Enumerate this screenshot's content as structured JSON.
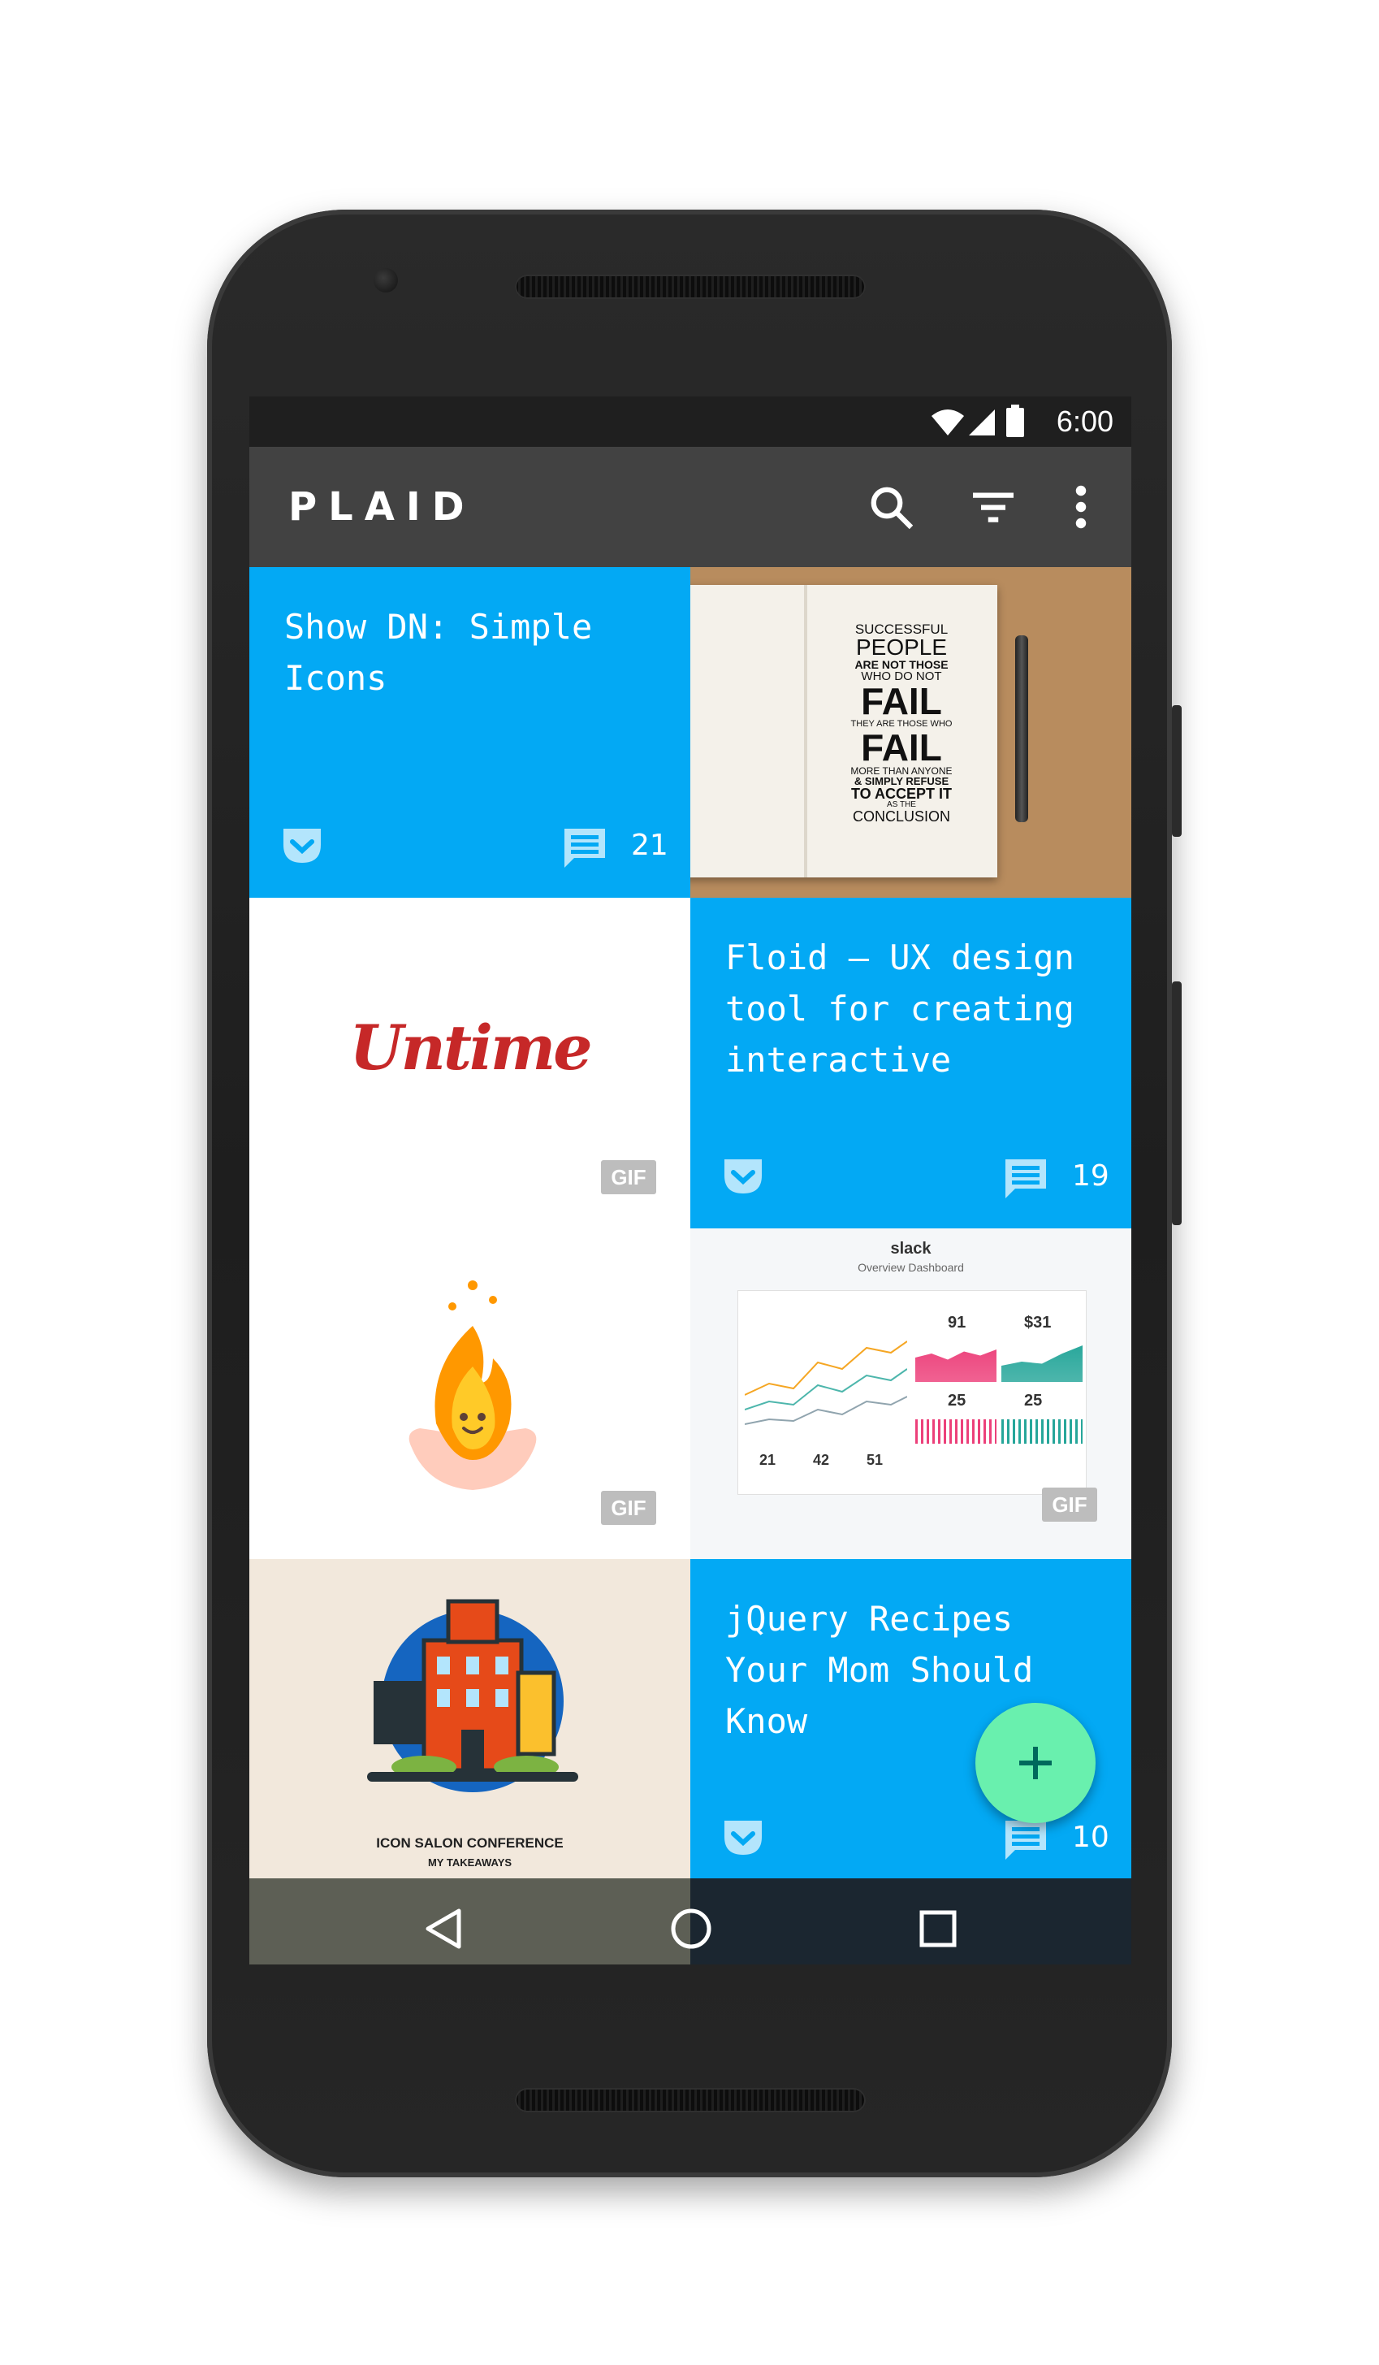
{
  "status_bar": {
    "time": "6:00",
    "icons": [
      "wifi-icon",
      "signal-icon",
      "battery-icon"
    ]
  },
  "app_bar": {
    "title": "PLAID",
    "actions": [
      "search-icon",
      "filter-icon",
      "more-vert-icon"
    ]
  },
  "tiles": [
    {
      "title": "Show DN: Simple Icons",
      "comments": "21",
      "source": "pocket-icon"
    },
    {
      "image_text": [
        "SUCCESSFUL",
        "PEOPLE",
        "ARE NOT THOSE",
        "WHO DO NOT",
        "FAIL",
        "THEY ARE THOSE WHO",
        "FAIL",
        "MORE THAN ANYONE",
        "& SIMPLY REFUSE",
        "TO ACCEPT IT",
        "AS THE",
        "CONCLUSION"
      ]
    },
    {
      "image_text": "Untime",
      "badge": "GIF"
    },
    {
      "title": "Floid – UX design tool for creating interactive",
      "comments": "19",
      "source": "pocket-icon"
    },
    {
      "badge": "GIF"
    },
    {
      "badge": "GIF",
      "logo": "slack",
      "subtitle": "Overview Dashboard",
      "stats": [
        "91",
        "$31",
        "25",
        "25",
        "21",
        "42",
        "51"
      ]
    },
    {
      "caption": "ICON SALON CONFERENCE",
      "subcaption": "MY TAKEAWAYS"
    },
    {
      "title": "jQuery Recipes Your Mom Should Know",
      "comments": "10",
      "source": "pocket-icon"
    }
  ],
  "fab": {
    "icon": "add-icon",
    "label": "+"
  },
  "nav": {
    "icons": [
      "back-icon",
      "home-icon",
      "recents-icon"
    ]
  },
  "colors": {
    "primary": "#03a9f4",
    "appbar": "#424242",
    "fab": "#69f0ae",
    "badge": "#bdbdbd"
  }
}
